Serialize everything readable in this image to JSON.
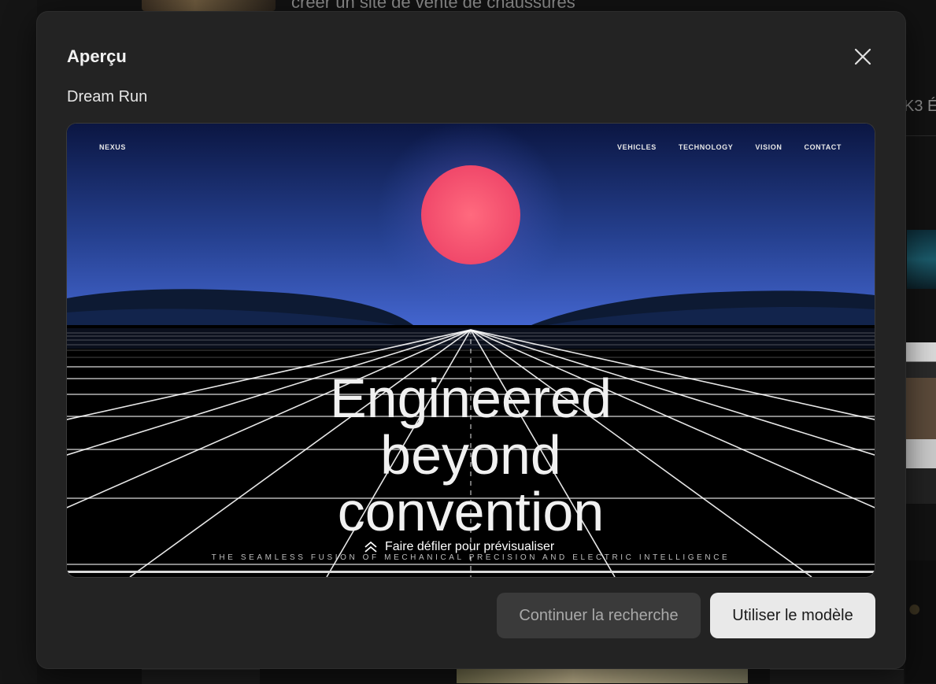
{
  "background": {
    "title_fragment": "créer un site de vente de chaussures",
    "right_fragment": "K3 É"
  },
  "modal": {
    "title": "Aperçu",
    "subtitle": "Dream Run",
    "close_icon": "close-icon"
  },
  "preview": {
    "site_logo": "NEXUS",
    "nav": [
      "VEHICLES",
      "TECHNOLOGY",
      "VISION",
      "CONTACT"
    ],
    "hero_lines": [
      "Engineered",
      "beyond",
      "convention"
    ],
    "tagline": "THE SEAMLESS FUSION OF MECHANICAL PRECISION AND ELECTRIC INTELLIGENCE",
    "scroll_hint": "Faire défiler pour prévisualiser",
    "scroll_icon": "double-chevron-up-icon",
    "colors": {
      "sun": "#f0506e",
      "sky_top": "#0c1a4a",
      "sky_bottom": "#3a5fc8",
      "grid": "#ffffff"
    }
  },
  "buttons": {
    "secondary": "Continuer la recherche",
    "primary": "Utiliser le modèle"
  }
}
